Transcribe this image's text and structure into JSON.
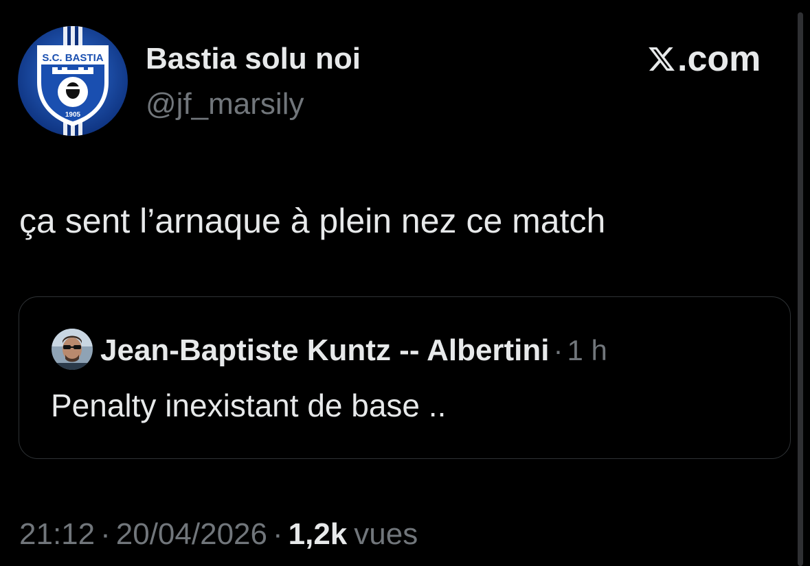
{
  "tweet": {
    "author": {
      "display_name": "Bastia solu noi",
      "handle": "@jf_marsily",
      "avatar_badge_text": "S.C. BASTIA",
      "avatar_badge_year": "1905",
      "avatar_icon": "sc-bastia-crest-icon"
    },
    "brand": {
      "logo_icon": "x-logo-icon",
      "text": ".com"
    },
    "text": "ça sent l’arnaque à plein nez ce match",
    "quoted": {
      "avatar_icon": "profile-photo",
      "author_name": "Jean-Baptiste Kuntz -- Albertini",
      "separator": "·",
      "time": "1 h",
      "text": "Penalty inexistant de base .."
    },
    "meta": {
      "time": "21:12",
      "date": "20/04/2026",
      "separator": "·",
      "views_count": "1,2k",
      "views_label": "vues"
    }
  },
  "colors": {
    "background": "#000000",
    "text_primary": "#e7e9ea",
    "text_secondary": "#71767b",
    "border": "#2f3336",
    "crest_blue": "#1a4fb0"
  }
}
